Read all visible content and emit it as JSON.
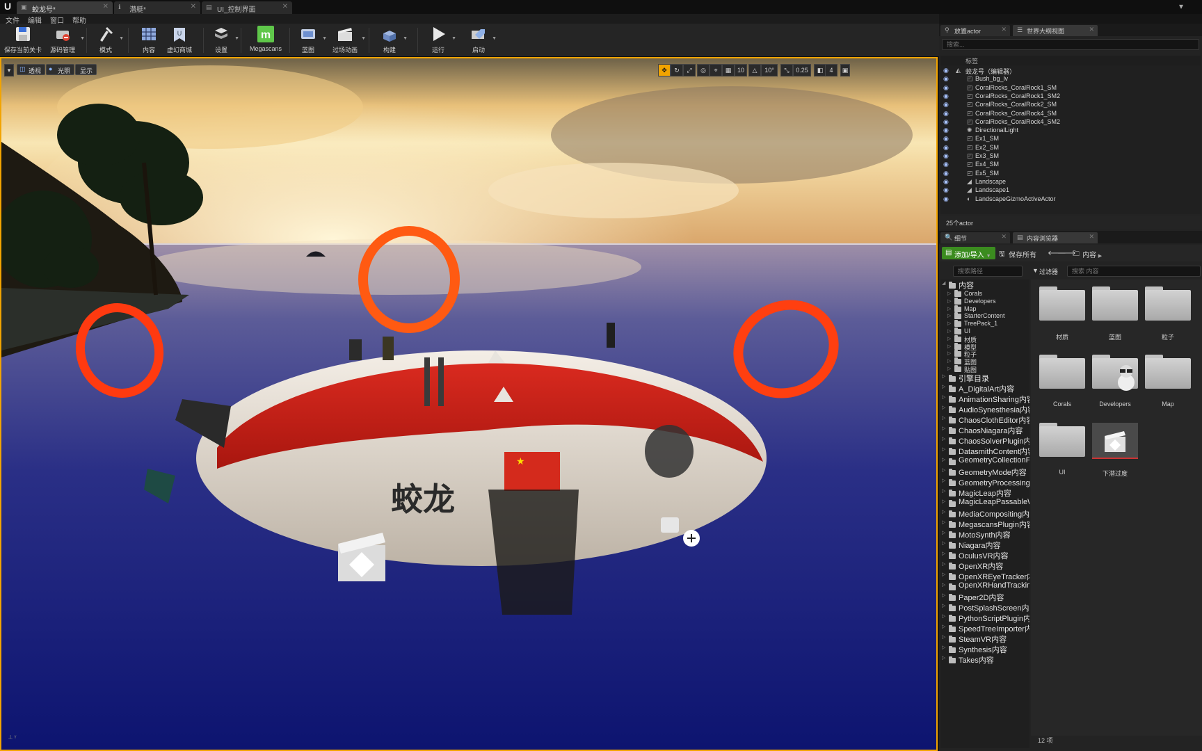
{
  "window": {
    "logo": "U",
    "tabs": [
      {
        "label": "蛟龙号*",
        "icon": "level-icon"
      },
      {
        "label": "潜艇*",
        "icon": "blueprint-icon"
      },
      {
        "label": "UI_控制界面",
        "icon": "widget-icon"
      }
    ]
  },
  "menu": [
    "文件",
    "编辑",
    "窗口",
    "帮助"
  ],
  "toolbar": {
    "items": [
      {
        "label": "保存当前关卡",
        "icon": "save-icon"
      },
      {
        "label": "源码管理",
        "icon": "source-control-icon"
      },
      {
        "label": "模式",
        "icon": "modes-icon"
      },
      {
        "label": "内容",
        "icon": "content-icon"
      },
      {
        "label": "虚幻商城",
        "icon": "marketplace-icon"
      },
      {
        "label": "设置",
        "icon": "settings-icon"
      },
      {
        "label": "Megascans",
        "icon": "megascans-icon"
      },
      {
        "label": "蓝图",
        "icon": "blueprint-icon"
      },
      {
        "label": "过场动画",
        "icon": "cinematics-icon"
      },
      {
        "label": "构建",
        "icon": "build-icon"
      },
      {
        "label": "运行",
        "icon": "play-icon"
      },
      {
        "label": "启动",
        "icon": "launch-icon"
      }
    ]
  },
  "viewport": {
    "buttons": [
      "透视",
      "光照",
      "显示"
    ],
    "snap": {
      "grid": "10",
      "rotation": "10°",
      "scale": "0.25",
      "camera_speed": "4"
    },
    "scene_text": "蛟龙"
  },
  "outliner": {
    "tabs": [
      "放置actor",
      "世界大纲视图"
    ],
    "search_placeholder": "搜索...",
    "column_label": "标签",
    "rows": [
      {
        "label": "蛟龙号（编辑器）",
        "level": 0,
        "icon": "world-icon"
      },
      {
        "label": "Bush_bg_lv",
        "level": 1,
        "icon": "mesh-icon"
      },
      {
        "label": "CoralRocks_CoralRock1_SM",
        "level": 1,
        "icon": "mesh-icon"
      },
      {
        "label": "CoralRocks_CoralRock1_SM2",
        "level": 1,
        "icon": "mesh-icon"
      },
      {
        "label": "CoralRocks_CoralRock2_SM",
        "level": 1,
        "icon": "mesh-icon"
      },
      {
        "label": "CoralRocks_CoralRock4_SM",
        "level": 1,
        "icon": "mesh-icon"
      },
      {
        "label": "CoralRocks_CoralRock4_SM2",
        "level": 1,
        "icon": "mesh-icon"
      },
      {
        "label": "DirectionalLight",
        "level": 1,
        "icon": "light-icon"
      },
      {
        "label": "Ex1_SM",
        "level": 1,
        "icon": "mesh-icon"
      },
      {
        "label": "Ex2_SM",
        "level": 1,
        "icon": "mesh-icon"
      },
      {
        "label": "Ex3_SM",
        "level": 1,
        "icon": "mesh-icon"
      },
      {
        "label": "Ex4_SM",
        "level": 1,
        "icon": "mesh-icon"
      },
      {
        "label": "Ex5_SM",
        "level": 1,
        "icon": "mesh-icon"
      },
      {
        "label": "Landscape",
        "level": 1,
        "icon": "landscape-icon"
      },
      {
        "label": "Landscape1",
        "level": 1,
        "icon": "landscape-icon"
      },
      {
        "label": "LandscapeGizmoActiveActor",
        "level": 1,
        "icon": "gizmo-icon"
      }
    ],
    "count": "25个actor"
  },
  "content_browser": {
    "tabs": [
      "细节",
      "内容浏览器"
    ],
    "add_label": "添加/导入",
    "save_all": "保存所有",
    "path": "内容",
    "search_paths_placeholder": "搜索路径",
    "filters_label": "过滤器",
    "search_content_placeholder": "搜索 内容",
    "tree": [
      {
        "label": "内容",
        "level": 0,
        "big": true,
        "expanded": true
      },
      {
        "label": "Corals",
        "level": 1
      },
      {
        "label": "Developers",
        "level": 1
      },
      {
        "label": "Map",
        "level": 1
      },
      {
        "label": "StarterContent",
        "level": 1
      },
      {
        "label": "TreePack_1",
        "level": 1
      },
      {
        "label": "UI",
        "level": 1
      },
      {
        "label": "材质",
        "level": 1
      },
      {
        "label": "模型",
        "level": 1
      },
      {
        "label": "粒子",
        "level": 1
      },
      {
        "label": "蓝图",
        "level": 1
      },
      {
        "label": "贴图",
        "level": 1
      },
      {
        "label": "引擎目录",
        "level": 0,
        "big": true
      },
      {
        "label": "A_DigitalArt内容",
        "level": 0,
        "big": true
      },
      {
        "label": "AnimationSharing内容",
        "level": 0,
        "big": true
      },
      {
        "label": "AudioSynesthesia内容",
        "level": 0,
        "big": true
      },
      {
        "label": "ChaosClothEditor内容",
        "level": 0,
        "big": true
      },
      {
        "label": "ChaosNiagara内容",
        "level": 0,
        "big": true
      },
      {
        "label": "ChaosSolverPlugin内容",
        "level": 0,
        "big": true
      },
      {
        "label": "DatasmithContent内容",
        "level": 0,
        "big": true
      },
      {
        "label": "GeometryCollectionPlugin",
        "level": 0,
        "big": true
      },
      {
        "label": "GeometryMode内容",
        "level": 0,
        "big": true
      },
      {
        "label": "GeometryProcessing内容",
        "level": 0,
        "big": true
      },
      {
        "label": "MagicLeap内容",
        "level": 0,
        "big": true
      },
      {
        "label": "MagicLeapPassableWorld",
        "level": 0,
        "big": true
      },
      {
        "label": "MediaCompositing内容",
        "level": 0,
        "big": true
      },
      {
        "label": "MegascansPlugin内容",
        "level": 0,
        "big": true
      },
      {
        "label": "MotoSynth内容",
        "level": 0,
        "big": true
      },
      {
        "label": "Niagara内容",
        "level": 0,
        "big": true
      },
      {
        "label": "OculusVR内容",
        "level": 0,
        "big": true
      },
      {
        "label": "OpenXR内容",
        "level": 0,
        "big": true
      },
      {
        "label": "OpenXREyeTracker内容",
        "level": 0,
        "big": true
      },
      {
        "label": "OpenXRHandTracking",
        "level": 0,
        "big": true
      },
      {
        "label": "Paper2D内容",
        "level": 0,
        "big": true
      },
      {
        "label": "PostSplashScreen内容",
        "level": 0,
        "big": true
      },
      {
        "label": "PythonScriptPlugin内容",
        "level": 0,
        "big": true
      },
      {
        "label": "SpeedTreeImporter内容",
        "level": 0,
        "big": true
      },
      {
        "label": "SteamVR内容",
        "level": 0,
        "big": true
      },
      {
        "label": "Synthesis内容",
        "level": 0,
        "big": true
      },
      {
        "label": "Takes内容",
        "level": 0,
        "big": true
      }
    ],
    "assets": [
      {
        "label": "材质",
        "kind": "folder"
      },
      {
        "label": "蓝图",
        "kind": "folder"
      },
      {
        "label": "粒子",
        "kind": "folder"
      },
      {
        "label": "Corals",
        "kind": "folder"
      },
      {
        "label": "Developers",
        "kind": "folder-dev"
      },
      {
        "label": "Map",
        "kind": "folder"
      },
      {
        "label": "UI",
        "kind": "folder"
      },
      {
        "label": "下潜过度",
        "kind": "sequence"
      }
    ],
    "item_count": "12 项"
  }
}
